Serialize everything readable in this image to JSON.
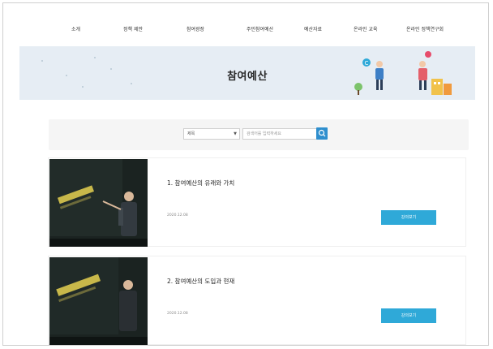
{
  "nav": {
    "items": [
      {
        "label": "소개"
      },
      {
        "label": "정책 제안"
      },
      {
        "label": "참여광장"
      },
      {
        "label": "주민참여예산"
      },
      {
        "label": "예산자료"
      },
      {
        "label": "온라인 교육"
      },
      {
        "label": "온라인 정책연구회"
      }
    ]
  },
  "banner": {
    "title": "참여예산"
  },
  "search": {
    "select_value": "제목",
    "placeholder": "검색어를 입력하세요"
  },
  "lectures": [
    {
      "title": "1. 참여예산의 유래와 가치",
      "date": "2020.12.08",
      "button_label": "강의보기"
    },
    {
      "title": "2. 참여예산의 도입과 현재",
      "date": "2020.12.08",
      "button_label": "강의보기"
    }
  ],
  "colors": {
    "banner_bg": "#e6edf4",
    "search_button": "#2f8fce",
    "card_button": "#2fa9d8"
  }
}
